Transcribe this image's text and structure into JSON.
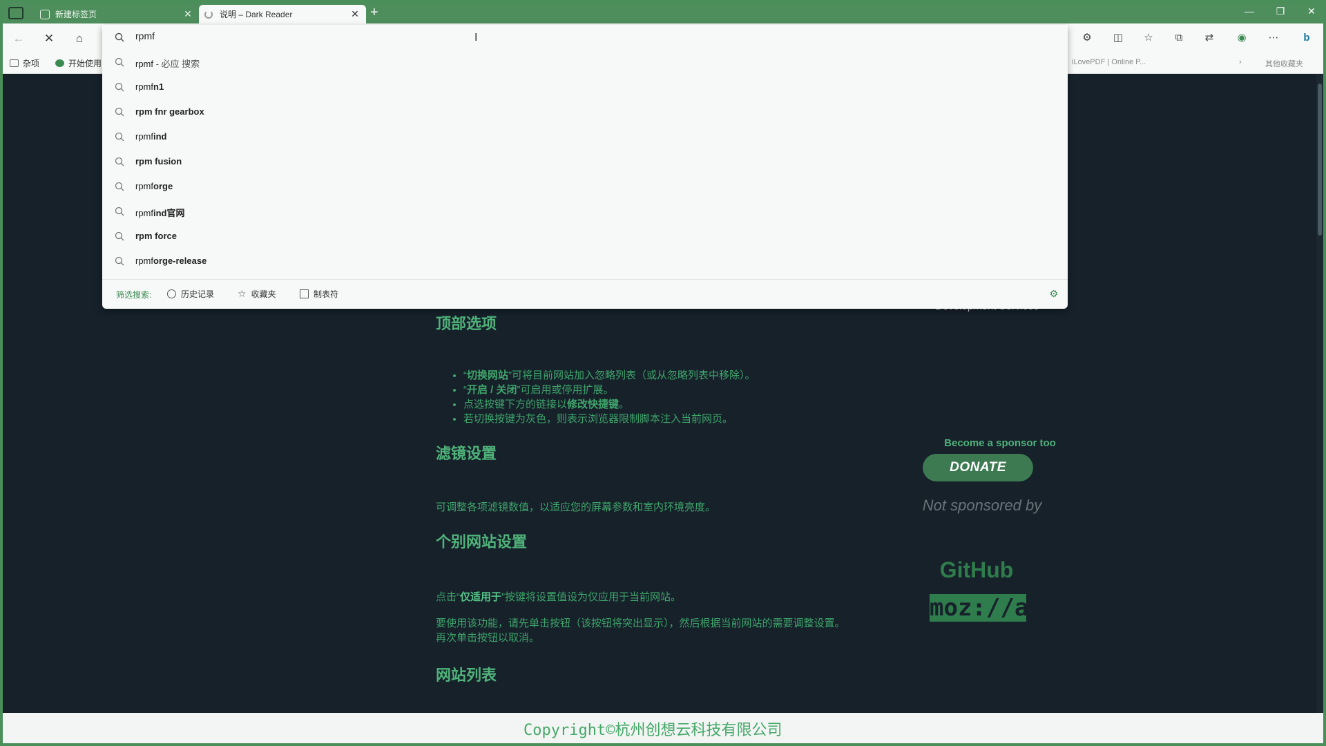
{
  "tabs": [
    {
      "label": "新建标签页"
    },
    {
      "label": "说明 – Dark Reader"
    }
  ],
  "toolbar": {
    "address_value": "rpmf"
  },
  "favorites": {
    "items": [
      {
        "label": "杂项"
      },
      {
        "label": "开始使用"
      }
    ],
    "right_text": "iLovePDF | Online P...",
    "right_folder": "其他收藏夹"
  },
  "suggestions": [
    {
      "prefix": "rpmf",
      "suffix": " - 必应 搜索",
      "bold": false
    },
    {
      "prefix": "rpmf",
      "suffix": "n1",
      "bold": true
    },
    {
      "prefix": "",
      "suffix": "rpm fnr gearbox",
      "bold": true
    },
    {
      "prefix": "rpmf",
      "suffix": "ind",
      "bold": true
    },
    {
      "prefix": "",
      "suffix": "rpm fusion",
      "bold": true
    },
    {
      "prefix": "rpmf",
      "suffix": "orge",
      "bold": true
    },
    {
      "prefix": "rpmf",
      "suffix": "ind官网",
      "bold": true
    },
    {
      "prefix": "",
      "suffix": "rpm force",
      "bold": true
    },
    {
      "prefix": "rpmf",
      "suffix": "orge-release",
      "bold": true
    }
  ],
  "omnibox_footer": {
    "filter_label": "筛选搜索:",
    "history": "历史记录",
    "favorites": "收藏夹",
    "tabs": "制表符"
  },
  "content": {
    "dev_services": "Development Services",
    "h_top": "顶部选项",
    "bullets": [
      {
        "pre": "“",
        "b": "切换网站",
        "post": "”可将目前网站加入忽略列表（或从忽略列表中移除）。"
      },
      {
        "pre": "“",
        "b": "开启 / 关闭",
        "post": "”可启用或停用扩展。"
      },
      {
        "pre": "点选按键下方的链接以",
        "b": "修改快捷键",
        "post": "。"
      },
      {
        "pre": "若切换按键为灰色，则表示浏览器限制脚本注入当前网页。",
        "b": "",
        "post": ""
      }
    ],
    "h_filter": "滤镜设置",
    "p_filter": "可调整各项滤镜数值，以适应您的屏幕参数和室内环境亮度。",
    "h_site": "个别网站设置",
    "p_site1_pre": "点击“",
    "p_site1_b": "仅适用于",
    "p_site1_post": "”按键将设置值设为仅应用于当前网站。",
    "p_site2_l1": "要使用该功能，请先单击按钮（该按钮将突出显示），然后根据当前网站的需要调整设置。",
    "p_site2_l2": "再次单击按钮以取消。",
    "h_list": "网站列表"
  },
  "sidebar": {
    "sponsor": "Become a sponsor too",
    "donate": "DONATE",
    "not_sponsored": "Not sponsored by",
    "github": "GitHub",
    "mozilla": "moz://a"
  },
  "watermark": "Copyright©杭州创想云科技有限公司",
  "colors": {
    "accent": "#4fb37a",
    "page_bg": "#16212a",
    "frame": "#4e8d5c"
  }
}
